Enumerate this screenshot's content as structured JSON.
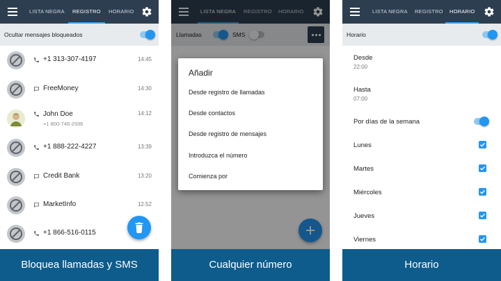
{
  "tabs": {
    "blacklist": "LISTA NEGRA",
    "log": "REGISTRO",
    "schedule": "HORARIO"
  },
  "colors": {
    "appbar": "#2d3e50",
    "accent": "#2196f3",
    "caption": "#0e5c8c",
    "subbar": "#e8ebee"
  },
  "panel1": {
    "subbar_label": "Ocultar mensajes bloqueados",
    "rows": [
      {
        "type": "call",
        "title": "+1 313-307-4197",
        "time": "14:45"
      },
      {
        "type": "message",
        "title": "FreeMoney",
        "time": "14:30"
      },
      {
        "type": "call",
        "title": "John Doe",
        "subtitle": "+1 800-746-2936",
        "time": "14:12"
      },
      {
        "type": "call",
        "title": "+1 888-222-4227",
        "time": "13:39"
      },
      {
        "type": "message",
        "title": "Credit Bank",
        "time": "13:20"
      },
      {
        "type": "message",
        "title": "MarketInfo",
        "time": "12:52"
      },
      {
        "type": "call",
        "title": "+1 866-516-0115",
        "time": ""
      }
    ],
    "caption": "Bloquea llamadas y SMS"
  },
  "panel2": {
    "calls_label": "Llamadas",
    "sms_label": "SMS",
    "dialog_title": "Añadir",
    "dialog_items": [
      "Desde registro de llamadas",
      "Desde contactos",
      "Desde registro de mensajes",
      "Introduzca el número",
      "Comienza por"
    ],
    "caption": "Cualquier número"
  },
  "panel3": {
    "subbar_label": "Horario",
    "from_label": "Desde",
    "from_value": "22:00",
    "to_label": "Hasta",
    "to_value": "07:00",
    "weekdays_label": "Por días de la semana",
    "days": [
      "Lunes",
      "Martes",
      "Miércoles",
      "Jueves",
      "Viernes"
    ],
    "caption": "Horario"
  }
}
